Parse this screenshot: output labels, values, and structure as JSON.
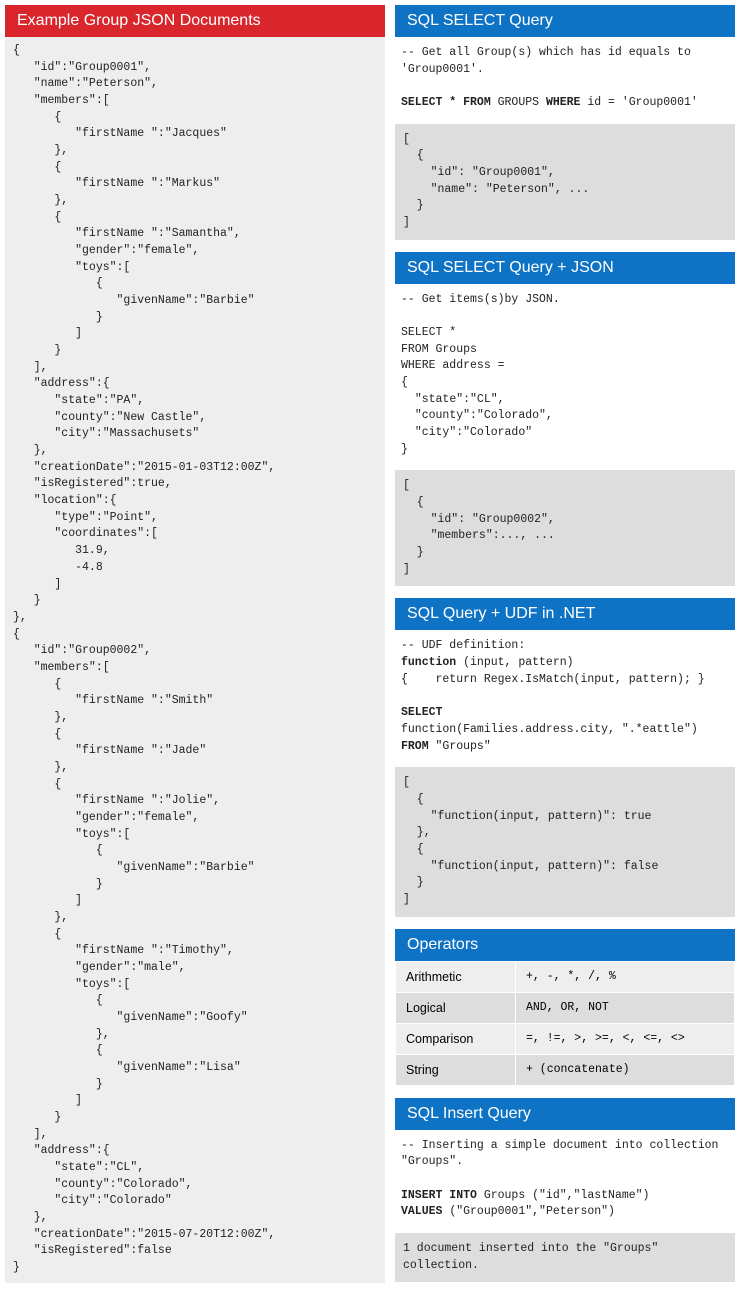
{
  "left": {
    "title": "Example Group JSON Documents",
    "code": "{\n   \"id\":\"Group0001\",\n   \"name\":\"Peterson\",\n   \"members\":[\n      {\n         \"firstName \":\"Jacques\"\n      },\n      {\n         \"firstName \":\"Markus\"\n      },\n      {\n         \"firstName \":\"Samantha\",\n         \"gender\":\"female\",\n         \"toys\":[\n            {\n               \"givenName\":\"Barbie\"\n            }\n         ]\n      }\n   ],\n   \"address\":{\n      \"state\":\"PA\",\n      \"county\":\"New Castle\",\n      \"city\":\"Massachusets\"\n   },\n   \"creationDate\":\"2015-01-03T12:00Z\",\n   \"isRegistered\":true,\n   \"location\":{\n      \"type\":\"Point\",\n      \"coordinates\":[\n         31.9,\n         -4.8\n      ]\n   }\n},\n{\n   \"id\":\"Group0002\",\n   \"members\":[\n      {\n         \"firstName \":\"Smith\"\n      },\n      {\n         \"firstName \":\"Jade\"\n      },\n      {\n         \"firstName \":\"Jolie\",\n         \"gender\":\"female\",\n         \"toys\":[\n            {\n               \"givenName\":\"Barbie\"\n            }\n         ]\n      },\n      {\n         \"firstName \":\"Timothy\",\n         \"gender\":\"male\",\n         \"toys\":[\n            {\n               \"givenName\":\"Goofy\"\n            },\n            {\n               \"givenName\":\"Lisa\"\n            }\n         ]\n      }\n   ],\n   \"address\":{\n      \"state\":\"CL\",\n      \"county\":\"Colorado\",\n      \"city\":\"Colorado\"\n   },\n   \"creationDate\":\"2015-07-20T12:00Z\",\n   \"isRegistered\":false\n}"
  },
  "sections": [
    {
      "title": "SQL SELECT Query",
      "query_html": "-- Get all Group(s) which has id equals to\n'Group0001'.\n\n<span class=\"kw\">SELECT * FROM</span> GROUPS <span class=\"kw\">WHERE</span> id = 'Group0001'",
      "result": "[\n  {\n    \"id\": \"Group0001\",\n    \"name\": \"Peterson\", ...\n  }\n]"
    },
    {
      "title": "SQL SELECT Query + JSON",
      "query_html": "-- Get items(s)by JSON.\n\nSELECT *\nFROM Groups\nWHERE address =\n{\n  \"state\":\"CL\",\n  \"county\":\"Colorado\",\n  \"city\":\"Colorado\"\n}",
      "result": "[\n  {\n    \"id\": \"Group0002\",\n    \"members\":..., ...\n  }\n]"
    },
    {
      "title": "SQL Query + UDF in .NET",
      "query_html": "-- UDF definition:\n<span class=\"kw\">function</span> (input, pattern)\n{    return Regex.IsMatch(input, pattern); }\n\n<span class=\"kw\">SELECT</span>\nfunction(Families.address.city, \".*eattle\")\n<span class=\"kw\">FROM</span> \"Groups\"",
      "result": "[\n  {\n    \"function(input, pattern)\": true\n  },\n  {\n    \"function(input, pattern)\": false\n  }\n]"
    }
  ],
  "operators": {
    "title": "Operators",
    "rows": [
      {
        "label": "Arithmetic",
        "ops": "+, -, *, /, %"
      },
      {
        "label": "Logical",
        "ops": "AND, OR, NOT"
      },
      {
        "label": "Comparison",
        "ops": "=, !=, >, >=, <, <=, <>"
      },
      {
        "label": "String",
        "ops": "+ (concatenate)"
      }
    ]
  },
  "insert": {
    "title": "SQL Insert Query",
    "query_html": "-- Inserting a simple document into collection\n\"Groups\".\n\n<span class=\"kw\">INSERT INTO</span> Groups (\"id\",\"lastName\")\n<span class=\"kw\">VALUES</span> (\"Group0001\",\"Peterson\")",
    "result": "1 document inserted into the \"Groups\"\ncollection."
  }
}
